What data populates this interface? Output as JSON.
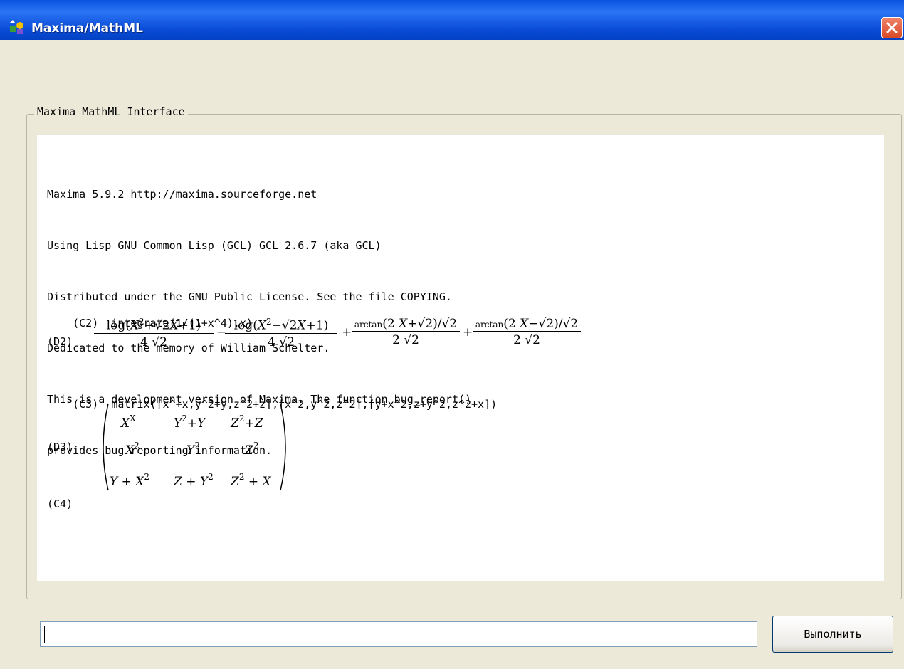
{
  "window": {
    "title": "Maxima/MathML",
    "icon": "maxima-app-icon",
    "close_icon": "close-icon"
  },
  "group": {
    "legend": "Maxima MathML Interface"
  },
  "output": {
    "banner": [
      "Maxima 5.9.2 http://maxima.sourceforge.net",
      "Using Lisp GNU Common Lisp (GCL) GCL 2.6.7 (aka GCL)",
      "Distributed under the GNU Public License. See the file COPYING.",
      "Dedicated to the memory of William Schelter.",
      "This is a development version of Maxima. The function bug_report()",
      "provides bug reporting information."
    ],
    "c2_label": "(C2)",
    "c2_input": "integrate(1/(1+x^4),x)",
    "d2_label": "(D2)",
    "d2": {
      "term1_num": "log",
      "term2_num": "log",
      "term3_num": "arctan",
      "term4_num": "arctan",
      "den_a": "4 √2",
      "den_b": "2 √2"
    },
    "c3_label": "(C3)",
    "c3_input": "matrix([x^+x,y^2+y,z^2+z],[x^2,y^2,z^2],[y+x^2,z+y^2,z^2+x])",
    "d3_label": "(D3)",
    "c4_label": "(C4)"
  },
  "input": {
    "value": ""
  },
  "run_button": {
    "label": "Выполнить"
  }
}
